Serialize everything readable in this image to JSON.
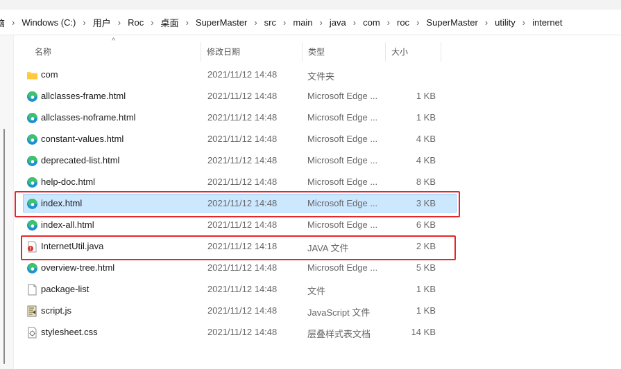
{
  "breadcrumb": [
    "脑",
    "Windows (C:)",
    "用户",
    "Roc",
    "桌面",
    "SuperMaster",
    "src",
    "main",
    "java",
    "com",
    "roc",
    "SuperMaster",
    "utility",
    "internet"
  ],
  "columns": {
    "name": "名称",
    "modified": "修改日期",
    "type": "类型",
    "size": "大小"
  },
  "files": [
    {
      "icon": "folder-icon",
      "name": "com",
      "modified": "2021/11/12 14:48",
      "type": "文件夹",
      "size": ""
    },
    {
      "icon": "edge-html-icon",
      "name": "allclasses-frame.html",
      "modified": "2021/11/12 14:48",
      "type": "Microsoft Edge ...",
      "size": "1 KB"
    },
    {
      "icon": "edge-html-icon",
      "name": "allclasses-noframe.html",
      "modified": "2021/11/12 14:48",
      "type": "Microsoft Edge ...",
      "size": "1 KB"
    },
    {
      "icon": "edge-html-icon",
      "name": "constant-values.html",
      "modified": "2021/11/12 14:48",
      "type": "Microsoft Edge ...",
      "size": "4 KB"
    },
    {
      "icon": "edge-html-icon",
      "name": "deprecated-list.html",
      "modified": "2021/11/12 14:48",
      "type": "Microsoft Edge ...",
      "size": "4 KB"
    },
    {
      "icon": "edge-html-icon",
      "name": "help-doc.html",
      "modified": "2021/11/12 14:48",
      "type": "Microsoft Edge ...",
      "size": "8 KB"
    },
    {
      "icon": "edge-html-icon",
      "name": "index.html",
      "modified": "2021/11/12 14:48",
      "type": "Microsoft Edge ...",
      "size": "3 KB",
      "selected": true
    },
    {
      "icon": "edge-html-icon",
      "name": "index-all.html",
      "modified": "2021/11/12 14:48",
      "type": "Microsoft Edge ...",
      "size": "6 KB"
    },
    {
      "icon": "java-file-icon",
      "name": "InternetUtil.java",
      "modified": "2021/11/12 14:18",
      "type": "JAVA 文件",
      "size": "2 KB"
    },
    {
      "icon": "edge-html-icon",
      "name": "overview-tree.html",
      "modified": "2021/11/12 14:48",
      "type": "Microsoft Edge ...",
      "size": "5 KB"
    },
    {
      "icon": "blank-file-icon",
      "name": "package-list",
      "modified": "2021/11/12 14:48",
      "type": "文件",
      "size": "1 KB"
    },
    {
      "icon": "script-file-icon",
      "name": "script.js",
      "modified": "2021/11/12 14:48",
      "type": "JavaScript 文件",
      "size": "1 KB"
    },
    {
      "icon": "css-file-icon",
      "name": "stylesheet.css",
      "modified": "2021/11/12 14:48",
      "type": "层叠样式表文档",
      "size": "14 KB"
    }
  ],
  "highlight_color": "#e8262a",
  "selection_color": "#cce8ff"
}
